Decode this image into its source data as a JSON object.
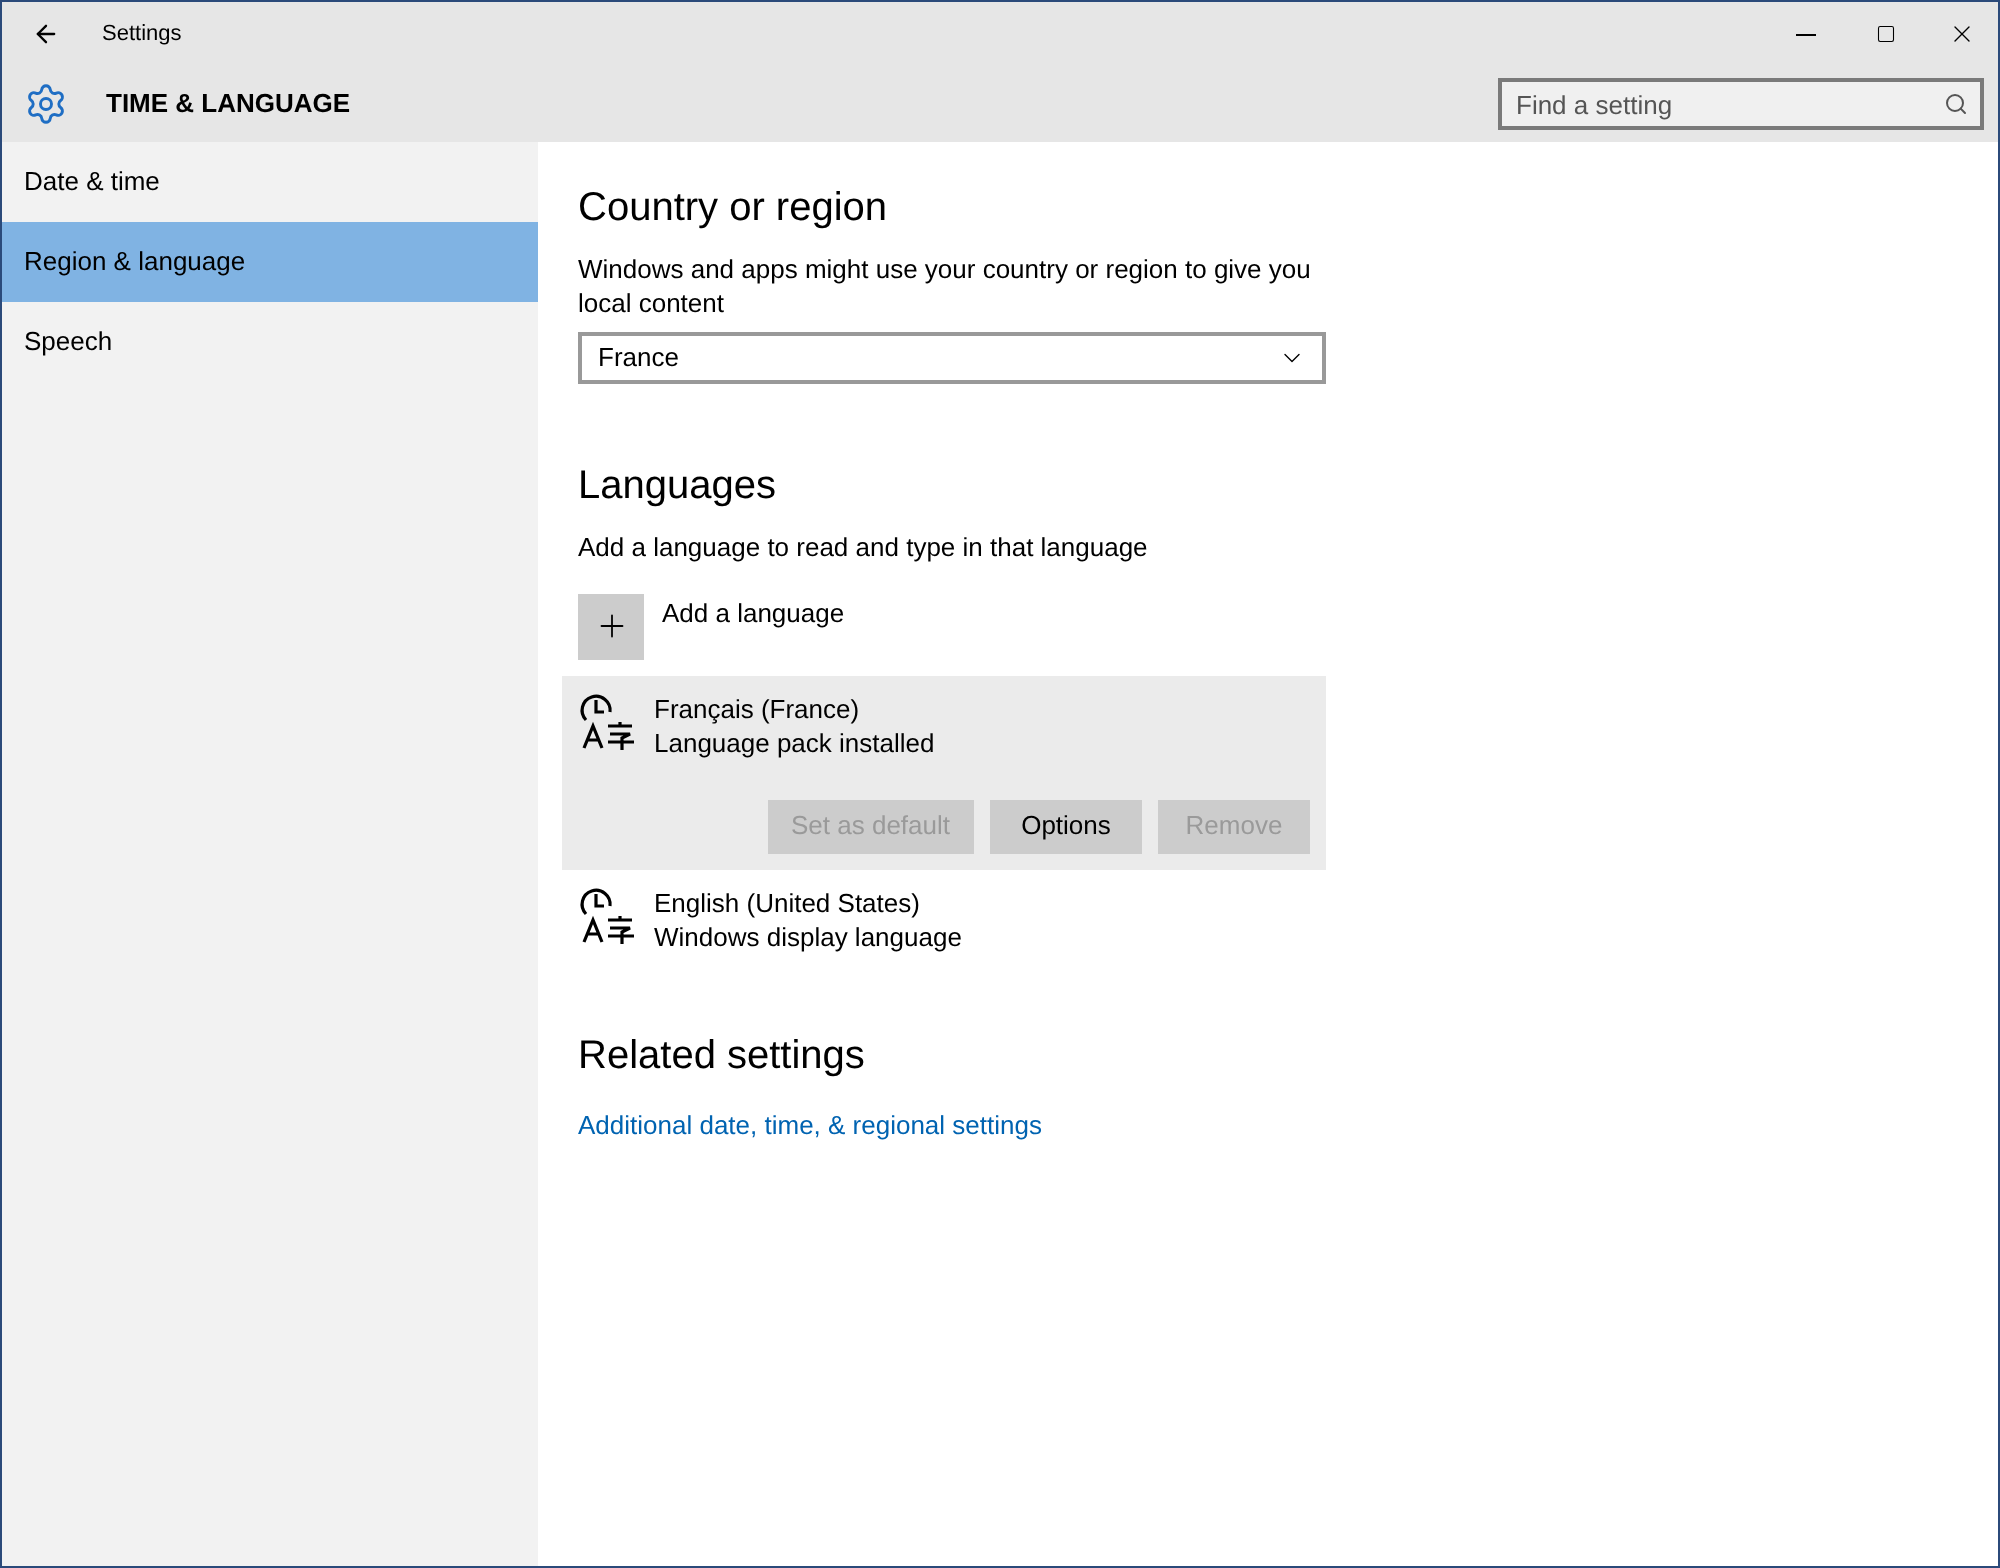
{
  "window": {
    "title": "Settings"
  },
  "header": {
    "title": "TIME & LANGUAGE"
  },
  "search": {
    "placeholder": "Find a setting"
  },
  "sidebar": {
    "items": [
      {
        "label": "Date & time",
        "selected": false
      },
      {
        "label": "Region & language",
        "selected": true
      },
      {
        "label": "Speech",
        "selected": false
      }
    ]
  },
  "country": {
    "heading": "Country or region",
    "description": "Windows and apps might use your country or region to give you local content",
    "value": "France"
  },
  "languages": {
    "heading": "Languages",
    "description": "Add a language to read and type in that language",
    "add_label": "Add a language",
    "items": [
      {
        "name": "Français (France)",
        "status": "Language pack installed",
        "selected": true,
        "buttons": [
          {
            "label": "Set as default",
            "disabled": true
          },
          {
            "label": "Options",
            "disabled": false
          },
          {
            "label": "Remove",
            "disabled": true
          }
        ]
      },
      {
        "name": "English (United States)",
        "status": "Windows display language",
        "selected": false
      }
    ]
  },
  "related": {
    "heading": "Related settings",
    "link": "Additional date, time, & regional settings"
  }
}
